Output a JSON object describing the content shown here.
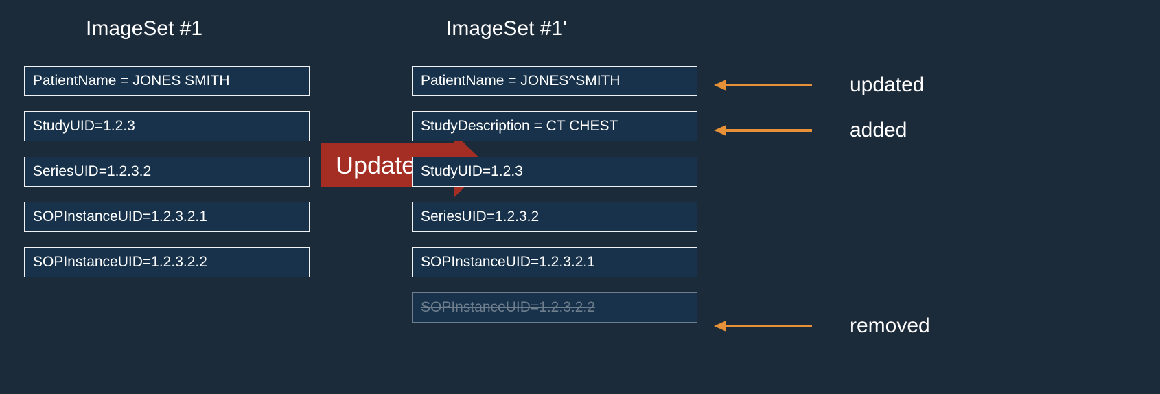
{
  "titles": {
    "left": "ImageSet #1",
    "right": "ImageSet #1'"
  },
  "left": {
    "items": [
      {
        "text": "PatientName = JONES SMITH"
      },
      {
        "text": "StudyUID=1.2.3"
      },
      {
        "text": "SeriesUID=1.2.3.2"
      },
      {
        "text": "SOPInstanceUID=1.2.3.2.1"
      },
      {
        "text": "SOPInstanceUID=1.2.3.2.2"
      }
    ]
  },
  "right": {
    "items": [
      {
        "text": "PatientName = JONES^SMITH",
        "state": "updated"
      },
      {
        "text": "StudyDescription = CT CHEST",
        "state": "added"
      },
      {
        "text": "StudyUID=1.2.3"
      },
      {
        "text": "SeriesUID=1.2.3.2"
      },
      {
        "text": "SOPInstanceUID=1.2.3.2.1"
      },
      {
        "text": "SOPInstanceUID=1.2.3.2.2",
        "state": "removed"
      }
    ]
  },
  "arrow": {
    "label": "Update"
  },
  "annotations": {
    "updated": "updated",
    "added": "added",
    "removed": "removed"
  },
  "colors": {
    "background": "#1c2b3a",
    "card_bg": "#17324a",
    "card_border": "#f0f2f4",
    "arrow_red": "#a42e24",
    "arrow_orange": "#e69138",
    "removed_text": "#6f7e8d"
  }
}
